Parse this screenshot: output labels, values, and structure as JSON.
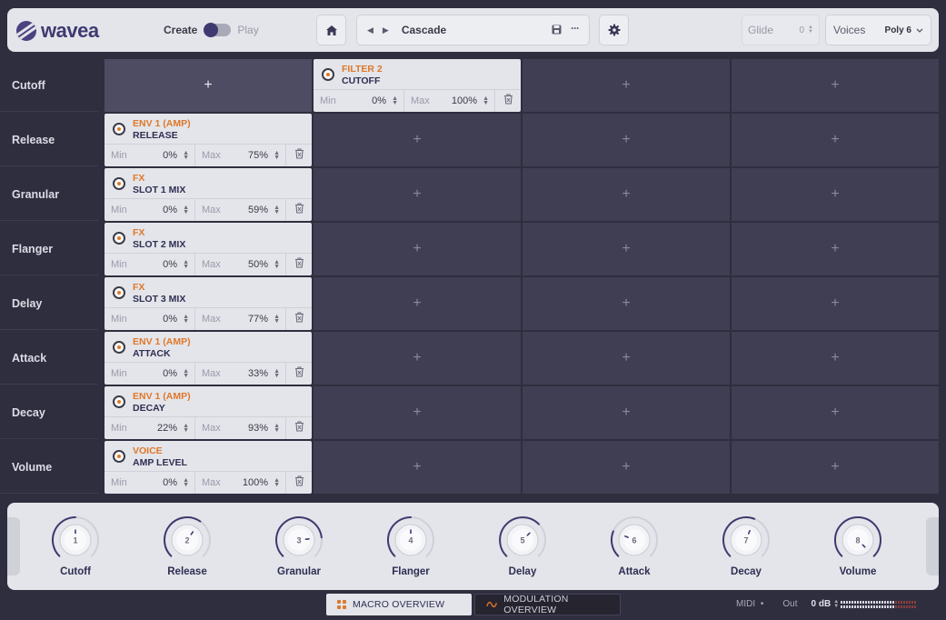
{
  "app": {
    "logo_text": "wavea"
  },
  "mode": {
    "create_label": "Create",
    "play_label": "Play"
  },
  "preset": {
    "name": "Cascade"
  },
  "glide": {
    "label": "Glide",
    "value": "0"
  },
  "voices": {
    "label": "Voices",
    "value": "Poly 6"
  },
  "rows": [
    {
      "label": "Cutoff"
    },
    {
      "label": "Release"
    },
    {
      "label": "Granular"
    },
    {
      "label": "Flanger"
    },
    {
      "label": "Delay"
    },
    {
      "label": "Attack"
    },
    {
      "label": "Decay"
    },
    {
      "label": "Volume"
    }
  ],
  "plus_symbol": "+",
  "field_labels": {
    "min": "Min",
    "max": "Max"
  },
  "modulations": [
    {
      "row": 0,
      "col": 1,
      "source": "FILTER 2",
      "target": "CUTOFF",
      "min": "0%",
      "max": "100%"
    },
    {
      "row": 1,
      "col": 0,
      "source": "ENV 1 (AMP)",
      "target": "RELEASE",
      "min": "0%",
      "max": "75%"
    },
    {
      "row": 2,
      "col": 0,
      "source": "FX",
      "target": "SLOT 1 MIX",
      "min": "0%",
      "max": "59%"
    },
    {
      "row": 3,
      "col": 0,
      "source": "FX",
      "target": "SLOT 2 MIX",
      "min": "0%",
      "max": "50%"
    },
    {
      "row": 4,
      "col": 0,
      "source": "FX",
      "target": "SLOT 3 MIX",
      "min": "0%",
      "max": "77%"
    },
    {
      "row": 5,
      "col": 0,
      "source": "ENV 1 (AMP)",
      "target": "ATTACK",
      "min": "0%",
      "max": "33%"
    },
    {
      "row": 6,
      "col": 0,
      "source": "ENV 1 (AMP)",
      "target": "DECAY",
      "min": "22%",
      "max": "93%"
    },
    {
      "row": 7,
      "col": 0,
      "source": "VOICE",
      "target": "AMP LEVEL",
      "min": "0%",
      "max": "100%"
    }
  ],
  "active_cell": {
    "row": 0,
    "col": 0
  },
  "macros": [
    {
      "number": "1",
      "label": "Cutoff",
      "value": 0.5
    },
    {
      "number": "2",
      "label": "Release",
      "value": 0.63
    },
    {
      "number": "3",
      "label": "Granular",
      "value": 0.81
    },
    {
      "number": "4",
      "label": "Flanger",
      "value": 0.5
    },
    {
      "number": "5",
      "label": "Delay",
      "value": 0.67
    },
    {
      "number": "6",
      "label": "Attack",
      "value": 0.25
    },
    {
      "number": "7",
      "label": "Decay",
      "value": 0.58
    },
    {
      "number": "8",
      "label": "Volume",
      "value": 1.0
    }
  ],
  "tabs": {
    "macro_overview": "MACRO OVERVIEW",
    "modulation_overview": "MODULATION OVERVIEW"
  },
  "footer": {
    "midi_label": "MIDI",
    "midi_dot": "•",
    "out_label": "Out",
    "out_value": "0 dB"
  },
  "colors": {
    "accent": "#e0782a",
    "brand": "#3f3a70",
    "panel": "#e3e5ea",
    "background": "#2f2e3f"
  }
}
